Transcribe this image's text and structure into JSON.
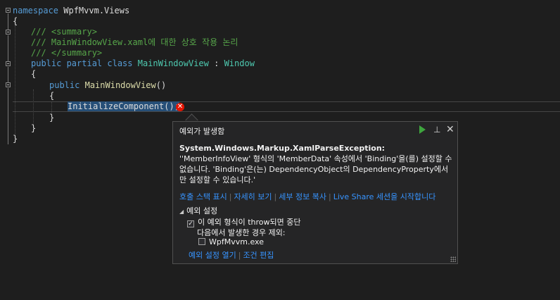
{
  "code": {
    "l1_kw": "namespace",
    "l1_name": " WpfMvvm.Views",
    "l2": "{",
    "l3": "/// <summary>",
    "l4": "/// MainWindowView.xaml에 대한 상호 작용 논리",
    "l5": "/// </summary>",
    "l6_kw": "public partial class",
    "l6_cls": "MainWindowView",
    "l6_colon": " : ",
    "l6_base": "Window",
    "l7": "{",
    "l8_kw": "public",
    "l8_fn": "MainWindowView",
    "l8_paren": "()",
    "l9": "{",
    "l10_call": "InitializeComponent();",
    "l11": "}",
    "l12": "}",
    "l13": "}"
  },
  "exception_popup": {
    "title": "예외가 발생함",
    "continue_icon": "play-icon",
    "pin_icon": "pin-icon",
    "close_icon": "close-icon",
    "exception_type": "System.Windows.Markup.XamlParseException:",
    "message_rest": " ''MemberInfoView' 형식의 'MemberData' 속성에서 'Binding'을(를) 설정할 수 없습니다. 'Binding'은(는) DependencyObject의 DependencyProperty에서만 설정할 수 있습니다.'",
    "links": [
      "호출 스택 표시",
      "자세히 보기",
      "세부 정보 복사",
      "Live Share 세션을 시작합니다"
    ],
    "settings_header": "예외 설정",
    "break_option": "이 예외 형식이 throw되면 중단",
    "break_checked": true,
    "except_label": "다음에서 발생한 경우 제외:",
    "module": "WpfMvvm.exe",
    "module_checked": false,
    "bottom_links": [
      "예외 설정 열기",
      "조건 편집"
    ]
  },
  "colors": {
    "background": "#1e1e1e",
    "keyword": "#569cd6",
    "type": "#4ec9b0",
    "method": "#dcdcaa",
    "comment": "#57a64a",
    "link": "#3794ff",
    "error": "#e51400",
    "continue": "#3ea53e"
  }
}
